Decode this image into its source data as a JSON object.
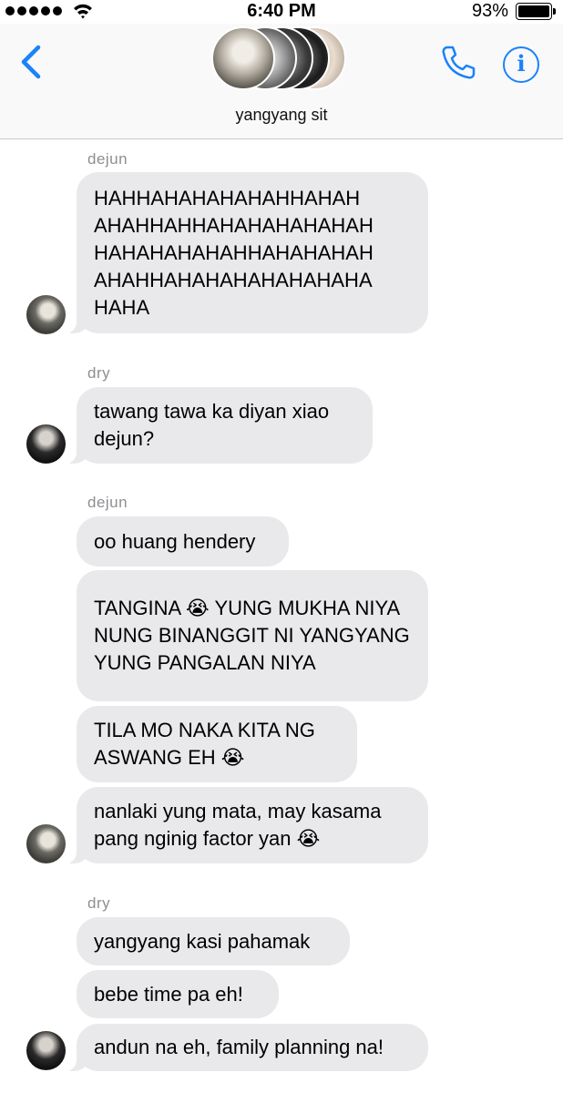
{
  "status_bar": {
    "time": "6:40 PM",
    "battery": "93%"
  },
  "header": {
    "group_name": "yangyang sit"
  },
  "colors": {
    "accent": "#1a82fb",
    "bubble": "#e9e9eb",
    "sender": "#8e8e93"
  },
  "icons": {
    "back": "chevron-left",
    "call": "phone",
    "info": "info-circle"
  },
  "messages": [
    {
      "sender": "dejun",
      "text": "HAHHAHAHAHAHAHHAHAH AHAHHAHHAHAHAHAHAHAH HAHAHAHAHAHHAHAHAHAH AHAHHAHAHAHAHAHAHAHA HAHA"
    },
    {
      "sender": "dry",
      "text": "tawang tawa ka diyan xiao dejun?"
    },
    {
      "sender": "dejun",
      "text": "oo huang hendery"
    },
    {
      "sender": "",
      "text": "TANGINA 😭 YUNG MUKHA NIYA NUNG BINANGGIT NI YANGYANG YUNG PANGALAN NIYA"
    },
    {
      "sender": "",
      "text": "TILA MO NAKA KITA NG ASWANG EH 😭"
    },
    {
      "sender": "",
      "text": "nanlaki yung mata, may kasama pang nginig factor yan 😭"
    },
    {
      "sender": "dry",
      "text": "yangyang kasi pahamak"
    },
    {
      "sender": "",
      "text": "bebe time pa eh!"
    },
    {
      "sender": "",
      "text": "andun na eh, family planning na!"
    }
  ]
}
